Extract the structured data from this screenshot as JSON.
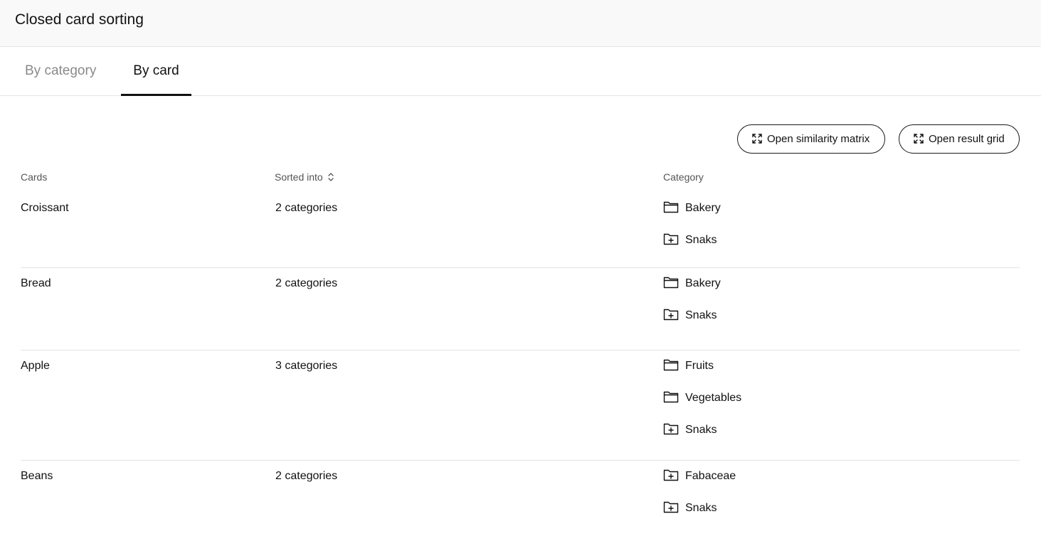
{
  "header": {
    "title": "Closed card sorting"
  },
  "tabs": [
    {
      "label": "By category",
      "active": false
    },
    {
      "label": "By card",
      "active": true
    }
  ],
  "actions": {
    "similarity_matrix_label": "Open similarity matrix",
    "result_grid_label": "Open result grid",
    "icon": "expand-icon"
  },
  "table": {
    "columns": {
      "cards": "Cards",
      "sorted_into": "Sorted into",
      "category": "Category"
    },
    "rows": [
      {
        "card": "Croissant",
        "sorted": "2 categories",
        "categories": [
          {
            "name": "Bakery",
            "icon": "folder-icon"
          },
          {
            "name": "Snaks",
            "icon": "folder-plus-icon"
          }
        ]
      },
      {
        "card": "Bread",
        "sorted": "2 categories",
        "categories": [
          {
            "name": "Bakery",
            "icon": "folder-icon"
          },
          {
            "name": "Snaks",
            "icon": "folder-plus-icon"
          }
        ]
      },
      {
        "card": "Apple",
        "sorted": "3 categories",
        "categories": [
          {
            "name": "Fruits",
            "icon": "folder-icon"
          },
          {
            "name": "Vegetables",
            "icon": "folder-icon"
          },
          {
            "name": "Snaks",
            "icon": "folder-plus-icon"
          }
        ]
      },
      {
        "card": "Beans",
        "sorted": "2 categories",
        "categories": [
          {
            "name": "Fabaceae",
            "icon": "folder-plus-icon"
          },
          {
            "name": "Snaks",
            "icon": "folder-plus-icon"
          }
        ]
      }
    ]
  }
}
